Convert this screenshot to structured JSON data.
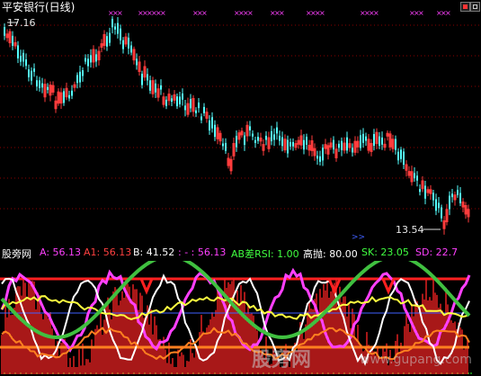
{
  "window": {
    "title": "平安银行(日线)"
  },
  "price_panel": {
    "high_label": "17.16",
    "low_label": "13.54",
    "scroll_marker": ">>",
    "colors": {
      "up": "#ff3c3c",
      "down": "#54ffff",
      "grid": "#8b0000",
      "signal": "#ff40ff"
    }
  },
  "indicator_bar": {
    "name": "股旁网",
    "a_label": "A: 56.13",
    "a1_label": "A1: 56.13",
    "b_label": "B: 41.52",
    "sep_label": ": - : 56.13",
    "ab_label": "AB差RSI: 1.00",
    "gaopao_label": "高抛: 80.00",
    "sk_label": "SK: 23.05",
    "sd_label": "SD: 22.7",
    "colors": {
      "name": "#ffffff",
      "a": "#ff40ff",
      "a1": "#ff4040",
      "b": "#ffffff",
      "sep": "#ff40ff",
      "ab": "#40ff40",
      "gaopao": "#ffffff",
      "sk": "#40ff40",
      "sd": "#ff40ff"
    }
  },
  "watermark": {
    "text": "股旁网",
    "url": "www.gupang.com"
  }
}
